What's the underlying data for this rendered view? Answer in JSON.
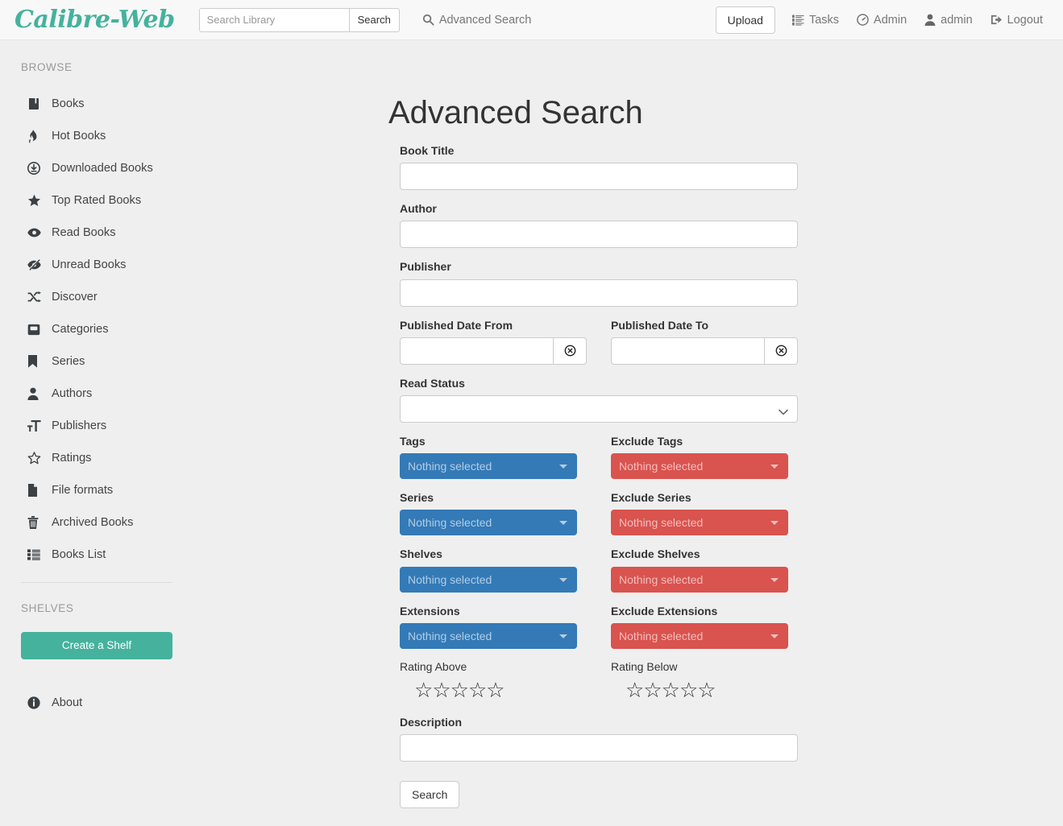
{
  "header": {
    "brand": "Calibre-Web",
    "search": {
      "placeholder": "Search Library",
      "value": "",
      "button_label": "Search"
    },
    "advanced_search_label": "Advanced Search",
    "upload_label": "Upload",
    "tasks_label": "Tasks",
    "admin_label": "Admin",
    "user_label": "admin",
    "logout_label": "Logout"
  },
  "sidebar": {
    "browse_heading": "BROWSE",
    "items": [
      {
        "label": "Books",
        "icon": "book-icon"
      },
      {
        "label": "Hot Books",
        "icon": "fire-icon"
      },
      {
        "label": "Downloaded Books",
        "icon": "download-circle-icon"
      },
      {
        "label": "Top Rated Books",
        "icon": "star-filled-icon"
      },
      {
        "label": "Read Books",
        "icon": "eye-icon"
      },
      {
        "label": "Unread Books",
        "icon": "eye-slash-icon"
      },
      {
        "label": "Discover",
        "icon": "shuffle-icon"
      },
      {
        "label": "Categories",
        "icon": "inbox-icon"
      },
      {
        "label": "Series",
        "icon": "bookmark-icon"
      },
      {
        "label": "Authors",
        "icon": "user-icon"
      },
      {
        "label": "Publishers",
        "icon": "text-size-icon"
      },
      {
        "label": "Ratings",
        "icon": "star-outline-icon"
      },
      {
        "label": "File formats",
        "icon": "file-icon"
      },
      {
        "label": "Archived Books",
        "icon": "trash-icon"
      },
      {
        "label": "Books List",
        "icon": "list-icon"
      }
    ],
    "shelves_heading": "SHELVES",
    "create_shelf_label": "Create a Shelf",
    "about_label": "About"
  },
  "main": {
    "title": "Advanced Search",
    "fields": {
      "book_title": {
        "label": "Book Title",
        "value": ""
      },
      "author": {
        "label": "Author",
        "value": ""
      },
      "publisher": {
        "label": "Publisher",
        "value": ""
      },
      "published_from": {
        "label": "Published Date From",
        "value": ""
      },
      "published_to": {
        "label": "Published Date To",
        "value": ""
      },
      "read_status": {
        "label": "Read Status",
        "value": ""
      },
      "tags": {
        "label": "Tags",
        "value": "Nothing selected"
      },
      "exclude_tags": {
        "label": "Exclude Tags",
        "value": "Nothing selected"
      },
      "series": {
        "label": "Series",
        "value": "Nothing selected"
      },
      "exclude_series": {
        "label": "Exclude Series",
        "value": "Nothing selected"
      },
      "shelves": {
        "label": "Shelves",
        "value": "Nothing selected"
      },
      "exclude_shelves": {
        "label": "Exclude Shelves",
        "value": "Nothing selected"
      },
      "extensions": {
        "label": "Extensions",
        "value": "Nothing selected"
      },
      "exclude_extensions": {
        "label": "Exclude Extensions",
        "value": "Nothing selected"
      },
      "rating_above": {
        "label": "Rating Above",
        "stars": 5,
        "filled": 0
      },
      "rating_below": {
        "label": "Rating Below",
        "stars": 5,
        "filled": 0
      },
      "description": {
        "label": "Description",
        "value": ""
      }
    },
    "submit_label": "Search"
  },
  "colors": {
    "brand_teal": "#45b29d",
    "include_blue": "#337ab7",
    "exclude_red": "#d9534f",
    "page_bg": "#efefef",
    "header_bg": "#f8f8f8"
  }
}
